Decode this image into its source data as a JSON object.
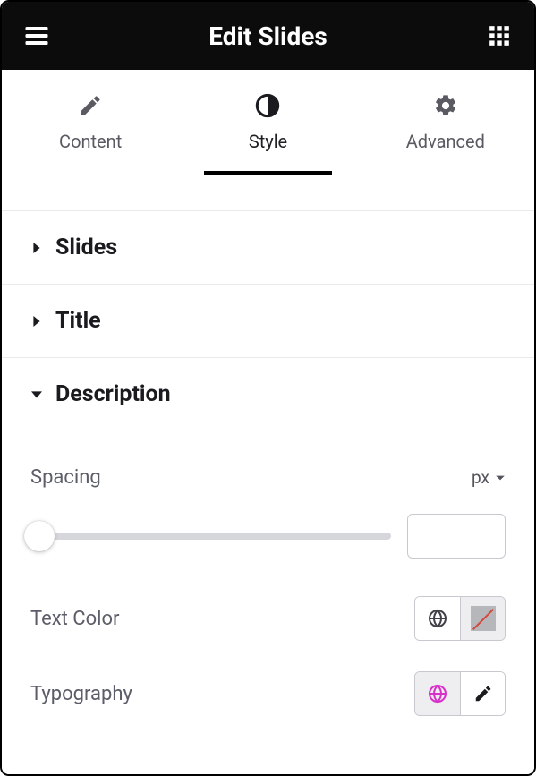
{
  "header": {
    "title": "Edit Slides"
  },
  "tabs": {
    "content": "Content",
    "style": "Style",
    "advanced": "Advanced",
    "active": "Style"
  },
  "sections": {
    "slides": {
      "title": "Slides",
      "expanded": false
    },
    "title_sec": {
      "title": "Title",
      "expanded": false
    },
    "description": {
      "title": "Description",
      "expanded": true,
      "spacing": {
        "label": "Spacing",
        "unit": "px",
        "value": ""
      },
      "text_color": {
        "label": "Text Color"
      },
      "typography": {
        "label": "Typography"
      }
    }
  }
}
